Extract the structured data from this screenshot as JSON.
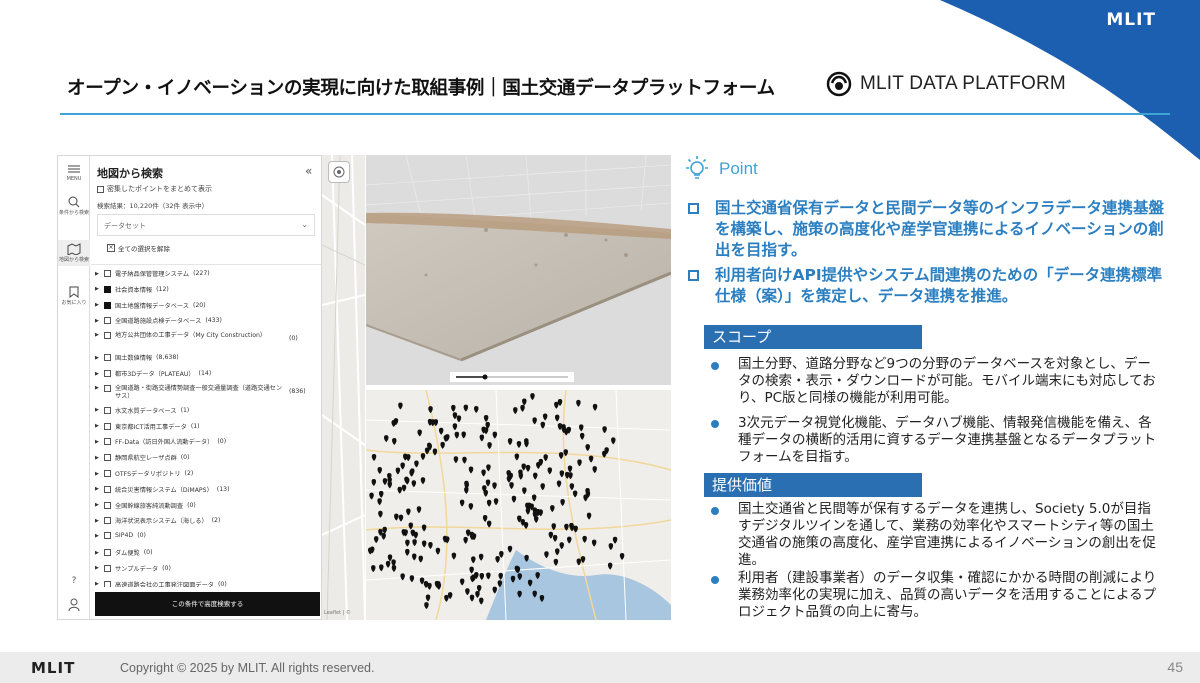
{
  "header": {
    "brand": "MLIT",
    "title": "オープン・イノベーションの実現に向けた取組事例｜国土交通データプラットフォーム",
    "platform_name": "MLIT DATA PLATFORM",
    "accent_color": "#3fa3d6",
    "swoosh_color": "#1c5fb0"
  },
  "app": {
    "rail": {
      "menu": "MENU",
      "filter": "条件から検索",
      "map": "地図から検索",
      "favorite": "お気に入り",
      "help": "?",
      "icons": [
        "menu-icon",
        "search-icon",
        "map-icon",
        "bookmark-icon",
        "help-icon",
        "user-icon"
      ]
    },
    "panel": {
      "title": "地図から検索",
      "collapse": "«",
      "cluster_label": "密集したポイントをまとめて表示",
      "result": "検索結果：10,220件（32件 表示中）",
      "dataset_placeholder": "データセット",
      "clear_label": "全ての選択を解除",
      "categories": [
        {
          "label": "電子納品保管管理システム",
          "count": "(227)",
          "checked": false
        },
        {
          "label": "社会資本情報",
          "count": "(12)",
          "checked": true
        },
        {
          "label": "国土地盤情報データベース",
          "count": "(20)",
          "checked": true
        },
        {
          "label": "全国道路施設点検データベース",
          "count": "(433)",
          "checked": false
        },
        {
          "label": "地方公共団体の工事データ（My City Construction）",
          "count": "(0)",
          "checked": false
        },
        {
          "label": "国土数値情報",
          "count": "(8,638)",
          "checked": false
        },
        {
          "label": "都市3Dデータ（PLATEAU）",
          "count": "(14)",
          "checked": false
        },
        {
          "label": "全国道路・街路交通情勢調査一般交通量調査（道路交通センサス）",
          "count": "(836)",
          "checked": false
        },
        {
          "label": "水文水質データベース",
          "count": "(1)",
          "checked": false
        },
        {
          "label": "東京都ICT活用工事データ",
          "count": "(1)",
          "checked": false
        },
        {
          "label": "FF-Data（訪日外国人流動データ）",
          "count": "(0)",
          "checked": false
        },
        {
          "label": "静岡県航空レーザ点群",
          "count": "(0)",
          "checked": false
        },
        {
          "label": "OTFSデータリポジトリ",
          "count": "(2)",
          "checked": false
        },
        {
          "label": "統合災害情報システム（DiMAPS）",
          "count": "(13)",
          "checked": false
        },
        {
          "label": "全国幹線旅客純流動調査",
          "count": "(0)",
          "checked": false
        },
        {
          "label": "海洋状況表示システム（海しる）",
          "count": "(2)",
          "checked": false
        },
        {
          "label": "SIP4D",
          "count": "(0)",
          "checked": false
        },
        {
          "label": "ダム便覧",
          "count": "(0)",
          "checked": false
        },
        {
          "label": "サンプルデータ",
          "count": "(0)",
          "checked": false
        },
        {
          "label": "高速道路会社の工事発注図面データ",
          "count": "(0)",
          "checked": false
        }
      ],
      "search_button": "この条件で高度検索する"
    },
    "map_attribution": "Leaflet | ©"
  },
  "point": {
    "label": "Point",
    "bullets": [
      "国土交通省保有データと民間データ等のインフラデータ連携基盤を構築し、施策の高度化や産学官連携によるイノベーションの創出を目指す。",
      "利用者向けAPI提供やシステム間連携のための「データ連携標準仕様（案）」を策定し、データ連携を推進。"
    ]
  },
  "scope": {
    "heading": "スコープ",
    "items": [
      "国土分野、道路分野など9つの分野のデータベースを対象とし、データの検索・表示・ダウンロードが可能。モバイル端末にも対応しており、PC版と同様の機能が利用可能。",
      "3次元データ視覚化機能、データハブ機能、情報発信機能を備え、各種データの横断的活用に資するデータ連携基盤となるデータプラットフォームを目指す。"
    ]
  },
  "value": {
    "heading": "提供価値",
    "items": [
      "国土交通省と民間等が保有するデータを連携し、Society 5.0が目指すデジタルツインを通して、業務の効率化やスマートシティ等の国土交通省の施策の高度化、産学官連携によるイノベーションの創出を促進。",
      "利用者（建設事業者）のデータ収集・確認にかかる時間の削減により業務効率化の実現に加え、品質の高いデータを活用することによるプロジェクト品質の向上に寄与。"
    ]
  },
  "footer": {
    "logo": "MLIT",
    "copyright": "Copyright © 2025 by MLIT. All rights reserved.",
    "page": "45"
  }
}
